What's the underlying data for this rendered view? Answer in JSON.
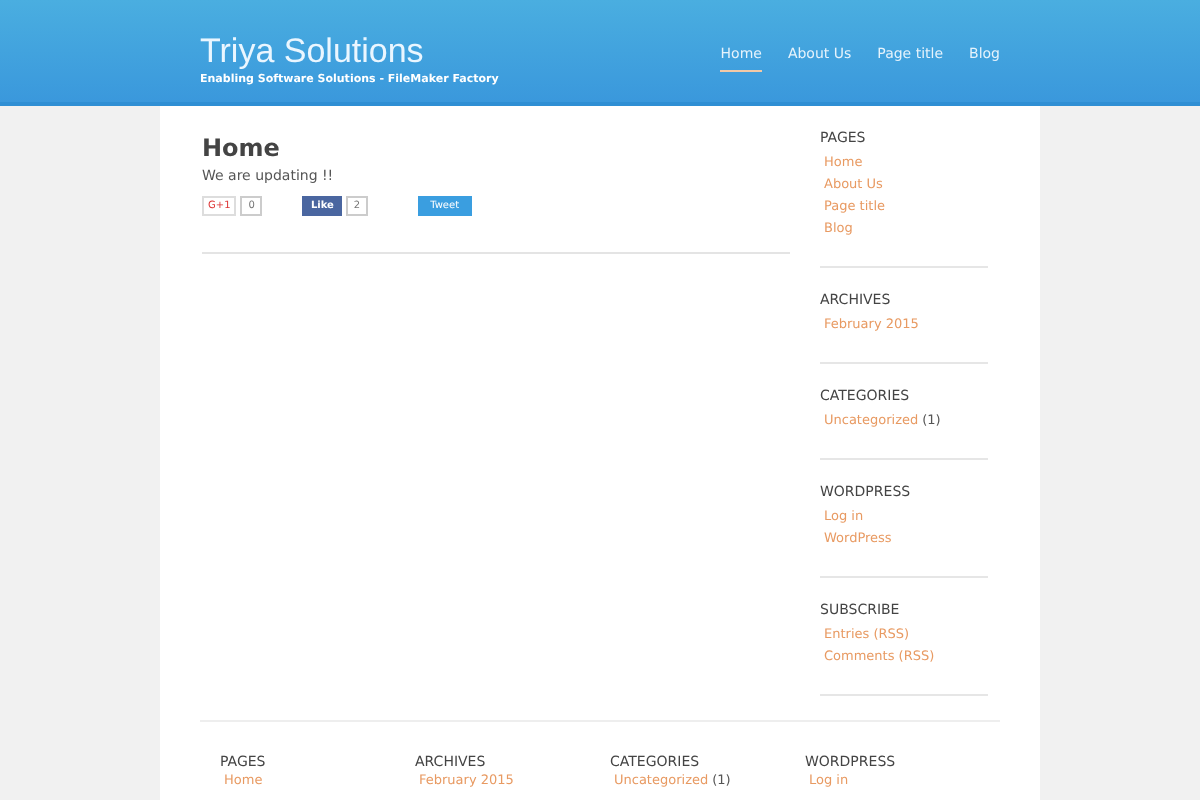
{
  "site": {
    "title": "Triya Solutions",
    "tagline": "Enabling Software Solutions - FileMaker Factory"
  },
  "nav": [
    {
      "label": "Home",
      "selected": true
    },
    {
      "label": "About Us",
      "selected": false
    },
    {
      "label": "Page title",
      "selected": false
    },
    {
      "label": "Blog",
      "selected": false
    }
  ],
  "post": {
    "title": "Home",
    "body": "We are updating !!",
    "share": [
      {
        "kind": "gplus",
        "label": "G+1",
        "count": "0"
      },
      {
        "kind": "facebook",
        "label": "Like",
        "count": "2"
      },
      {
        "kind": "twitter",
        "label": "Tweet"
      }
    ]
  },
  "sidebar": [
    {
      "title": "PAGES",
      "items": [
        {
          "label": "Home"
        },
        {
          "label": "About Us"
        },
        {
          "label": "Page title"
        },
        {
          "label": "Blog"
        }
      ]
    },
    {
      "title": "ARCHIVES",
      "items": [
        {
          "label": "February 2015"
        }
      ]
    },
    {
      "title": "CATEGORIES",
      "items": [
        {
          "label": "Uncategorized",
          "count": "(1)"
        }
      ]
    },
    {
      "title": "WORDPRESS",
      "items": [
        {
          "label": "Log in"
        },
        {
          "label": "WordPress"
        }
      ]
    },
    {
      "title": "SUBSCRIBE",
      "items": [
        {
          "label": "Entries (RSS)"
        },
        {
          "label": "Comments (RSS)"
        }
      ]
    }
  ],
  "footer": [
    {
      "title": "PAGES",
      "items": [
        {
          "label": "Home"
        }
      ]
    },
    {
      "title": "ARCHIVES",
      "items": [
        {
          "label": "February 2015"
        }
      ]
    },
    {
      "title": "CATEGORIES",
      "items": [
        {
          "label": "Uncategorized",
          "count": "(1)"
        }
      ]
    },
    {
      "title": "WORDPRESS",
      "items": [
        {
          "label": "Log in"
        }
      ]
    }
  ]
}
